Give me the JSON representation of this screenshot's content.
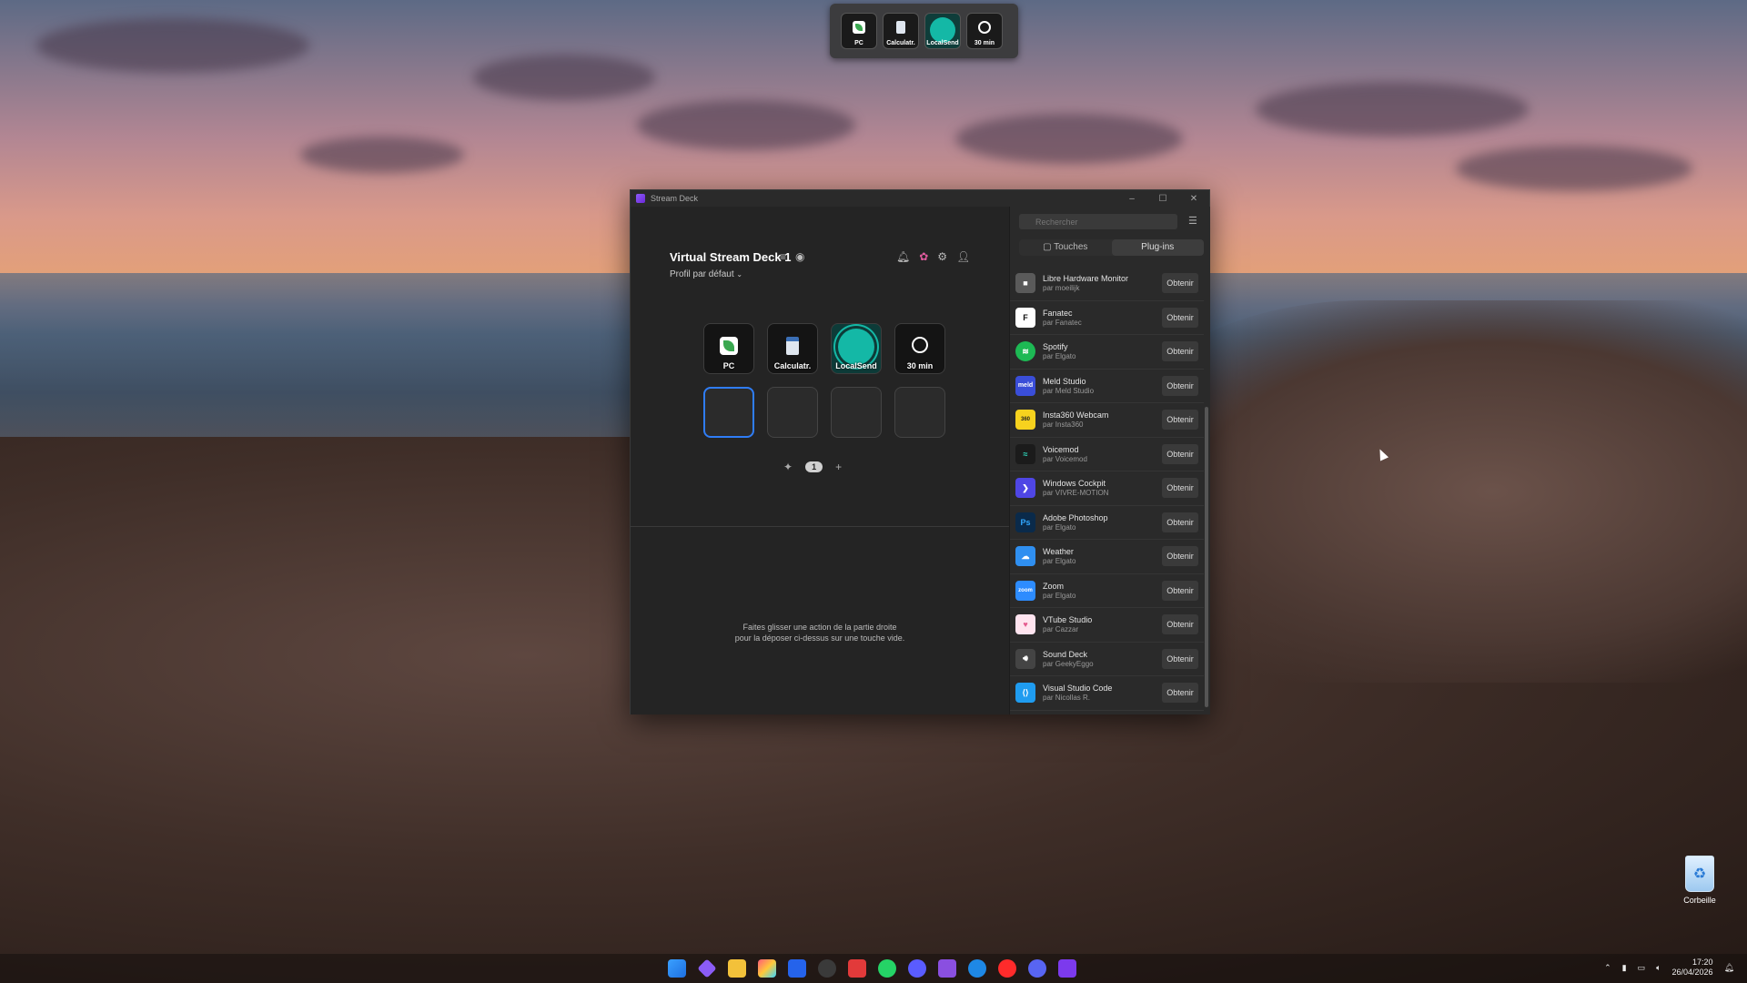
{
  "mini_deck": {
    "keys": [
      {
        "label": "PC",
        "icon": "leaf-icon"
      },
      {
        "label": "Calculatr.",
        "icon": "calculator-icon"
      },
      {
        "label": "LocalSend",
        "icon": "localsend-icon"
      },
      {
        "label": "30 min",
        "icon": "timer-icon"
      }
    ]
  },
  "window": {
    "title": "Stream Deck",
    "controls": [
      "–",
      "☐",
      "✕"
    ]
  },
  "deck": {
    "name": "Virtual Stream Deck 1",
    "profile": "Profil par défaut",
    "keys": [
      {
        "label": "PC"
      },
      {
        "label": "Calculatr."
      },
      {
        "label": "LocalSend"
      },
      {
        "label": "30 min"
      }
    ],
    "page": "1",
    "hint_line1": "Faites glisser une action de la partie droite",
    "hint_line2": "pour la déposer ci-dessus sur une touche vide."
  },
  "store": {
    "search_placeholder": "Rechercher",
    "tabs": [
      {
        "label": "Touches",
        "active": false
      },
      {
        "label": "Plug-ins",
        "active": true
      }
    ],
    "plugins": [
      {
        "name": "Libre Hardware Monitor",
        "by": "par moeilijk",
        "button": "Obtenir",
        "color": "#5a5a5a"
      },
      {
        "name": "Fanatec",
        "by": "par Fanatec",
        "button": "Obtenir",
        "color": "#ffffff"
      },
      {
        "name": "Spotify",
        "by": "par Elgato",
        "button": "Obtenir",
        "color": "#1db954"
      },
      {
        "name": "Meld Studio",
        "by": "par Meld Studio",
        "button": "Obtenir",
        "color": "#3a4ed8"
      },
      {
        "name": "Insta360 Webcam",
        "by": "par Insta360",
        "button": "Obtenir",
        "color": "#f7d21e"
      },
      {
        "name": "Voicemod",
        "by": "par Voicemod",
        "button": "Obtenir",
        "color": "#1b1b1b"
      },
      {
        "name": "Windows Cockpit",
        "by": "par VIVRE-MOTION",
        "button": "Obtenir",
        "color": "#4f46e5"
      },
      {
        "name": "Adobe Photoshop",
        "by": "par Elgato",
        "button": "Obtenir",
        "color": "#0a2a4a"
      },
      {
        "name": "Weather",
        "by": "par Elgato",
        "button": "Obtenir",
        "color": "#2f8ff0"
      },
      {
        "name": "Zoom",
        "by": "par Elgato",
        "button": "Obtenir",
        "color": "#2d8cff"
      },
      {
        "name": "VTube Studio",
        "by": "par Cazzar",
        "button": "Obtenir",
        "color": "#ffe4ef"
      },
      {
        "name": "Sound Deck",
        "by": "par GeekyEggo",
        "button": "Obtenir",
        "color": "#444444"
      },
      {
        "name": "Visual Studio Code",
        "by": "par Nicollas R.",
        "button": "Obtenir",
        "color": "#1f9cf0"
      }
    ]
  },
  "desktop": {
    "recycle_bin": "Corbeille"
  },
  "tray": {
    "time": "17:20",
    "date": "26/04/2026"
  },
  "colors": {
    "accent": "#2f7df6",
    "localsend": "#14b8a6"
  }
}
